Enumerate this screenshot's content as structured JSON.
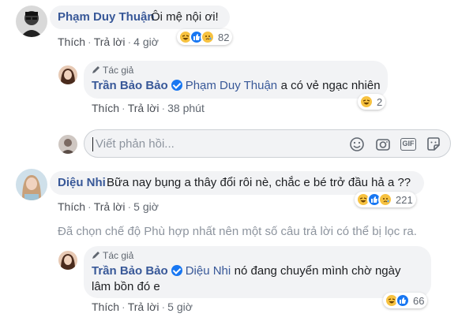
{
  "comments": [
    {
      "author": "Phạm Duy Thuận",
      "text": "Ôi mệ nội ơi!",
      "actions": {
        "like": "Thích",
        "reply": "Trả lời",
        "time": "4 giờ"
      },
      "reaction_count": "82",
      "reactions": [
        "haha-icon",
        "like-icon",
        "sad-icon"
      ]
    },
    {
      "author_badge": "Tác giả",
      "author": "Trần Bảo Bảo",
      "mention": "Phạm Duy Thuận",
      "text": "a có vẻ ngạc nhiên",
      "actions": {
        "like": "Thích",
        "reply": "Trả lời",
        "time": "38 phút"
      },
      "reaction_count": "2",
      "reactions": [
        "haha-icon"
      ]
    },
    {
      "author": "Diệu Nhi",
      "text": "Bữa nay bụng a thây đổi rôi nè, chắc e bé trở đầu hả a ??",
      "actions": {
        "like": "Thích",
        "reply": "Trả lời",
        "time": "5 giờ"
      },
      "reaction_count": "221",
      "reactions": [
        "haha-icon",
        "like-icon",
        "sad-icon"
      ]
    },
    {
      "author_badge": "Tác giả",
      "author": "Trần Bảo Bảo",
      "mention": "Diệu Nhi",
      "text_line1": "nó đang chuyển mình chờ ngày",
      "text_line2": "lâm bồn đó e",
      "actions": {
        "like": "Thích",
        "reply": "Trả lời",
        "time": "5 giờ"
      },
      "reaction_count": "66",
      "reactions": [
        "haha-icon",
        "like-icon"
      ]
    }
  ],
  "reply_box": {
    "placeholder": "Viết phản hồi...",
    "icons": [
      "emoji-icon",
      "camera-icon",
      "gif-icon",
      "sticker-icon"
    ],
    "gif_label": "GIF"
  },
  "filter_note": "Đã chọn chế độ Phù hợp nhất nên một số câu trả lời có thể bị lọc ra.",
  "colors": {
    "link": "#385898",
    "bubble": "#f2f3f5",
    "like": "#1877f2",
    "haha": "#f7c240"
  }
}
